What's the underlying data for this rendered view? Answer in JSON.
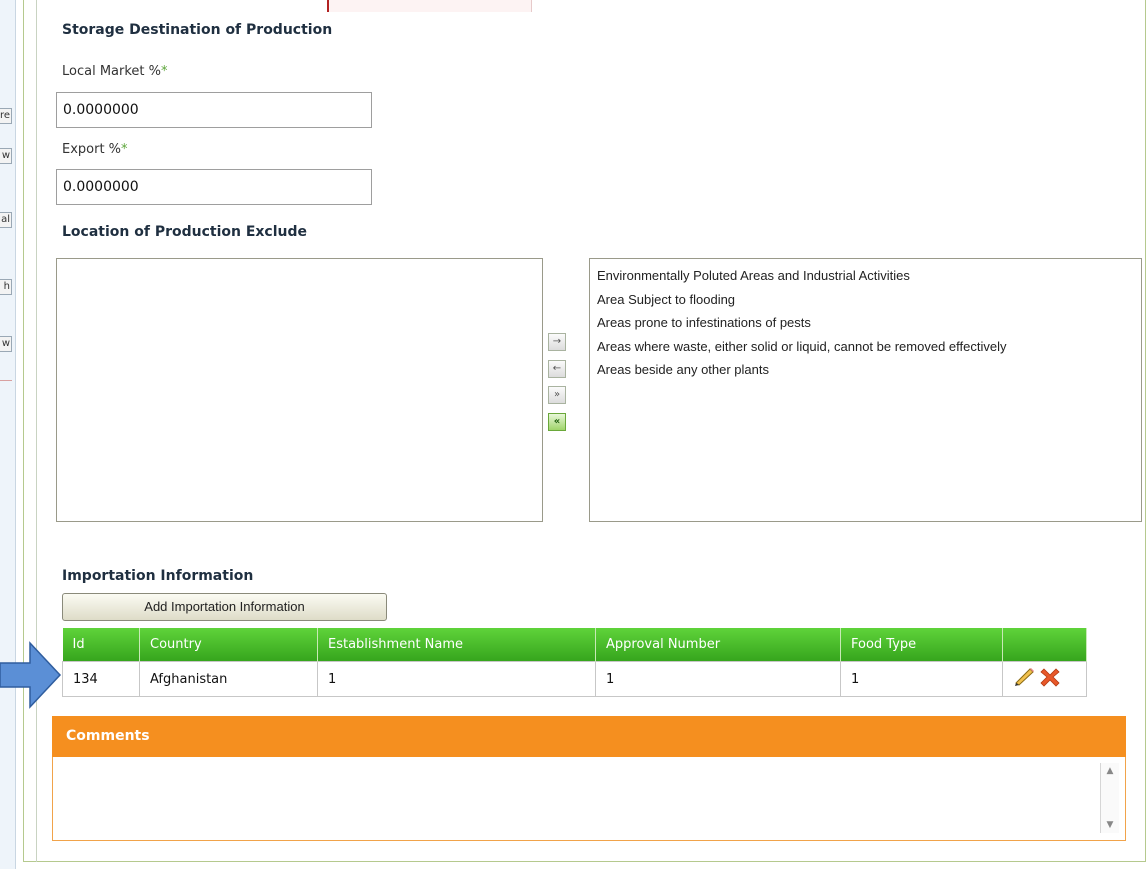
{
  "storage": {
    "title": "Storage Destination of Production",
    "local_market_label": "Local Market %",
    "local_market_value": "0.0000000",
    "export_label": "Export %",
    "export_value": "0.0000000",
    "required_mark": "*"
  },
  "location": {
    "title": "Location of Production Exclude",
    "selected_items": [],
    "available_items": [
      "Environmentally Poluted Areas and Industrial Activities",
      "Area Subject to flooding",
      "Areas prone to infestinations of pests",
      "Areas where waste, either solid or liquid, cannot be removed effectively",
      "Areas beside any other plants"
    ],
    "buttons": {
      "move_right": "→",
      "move_left": "←",
      "move_all_right": "»",
      "move_all_left": "«"
    }
  },
  "importation": {
    "title": "Importation Information",
    "add_button_label": "Add Importation Information",
    "columns": [
      "Id",
      "Country",
      "Establishment Name",
      "Approval Number",
      "Food Type",
      ""
    ],
    "rows": [
      {
        "id": "134",
        "country": "Afghanistan",
        "establishment": "1",
        "approval": "1",
        "food_type": "1"
      }
    ]
  },
  "comments": {
    "title": "Comments",
    "value": ""
  },
  "left_strip": {
    "fragments": [
      "re",
      "w",
      "al",
      "h",
      "w"
    ]
  },
  "icons": {
    "edit": "pencil-icon",
    "delete": "delete-x-icon",
    "pointer": "pointer-arrow"
  },
  "colors": {
    "grid_header": "#42b828",
    "comments_header": "#f58f1f",
    "required": "#5ca53a",
    "pointer_arrow": "#5b8fd6"
  }
}
